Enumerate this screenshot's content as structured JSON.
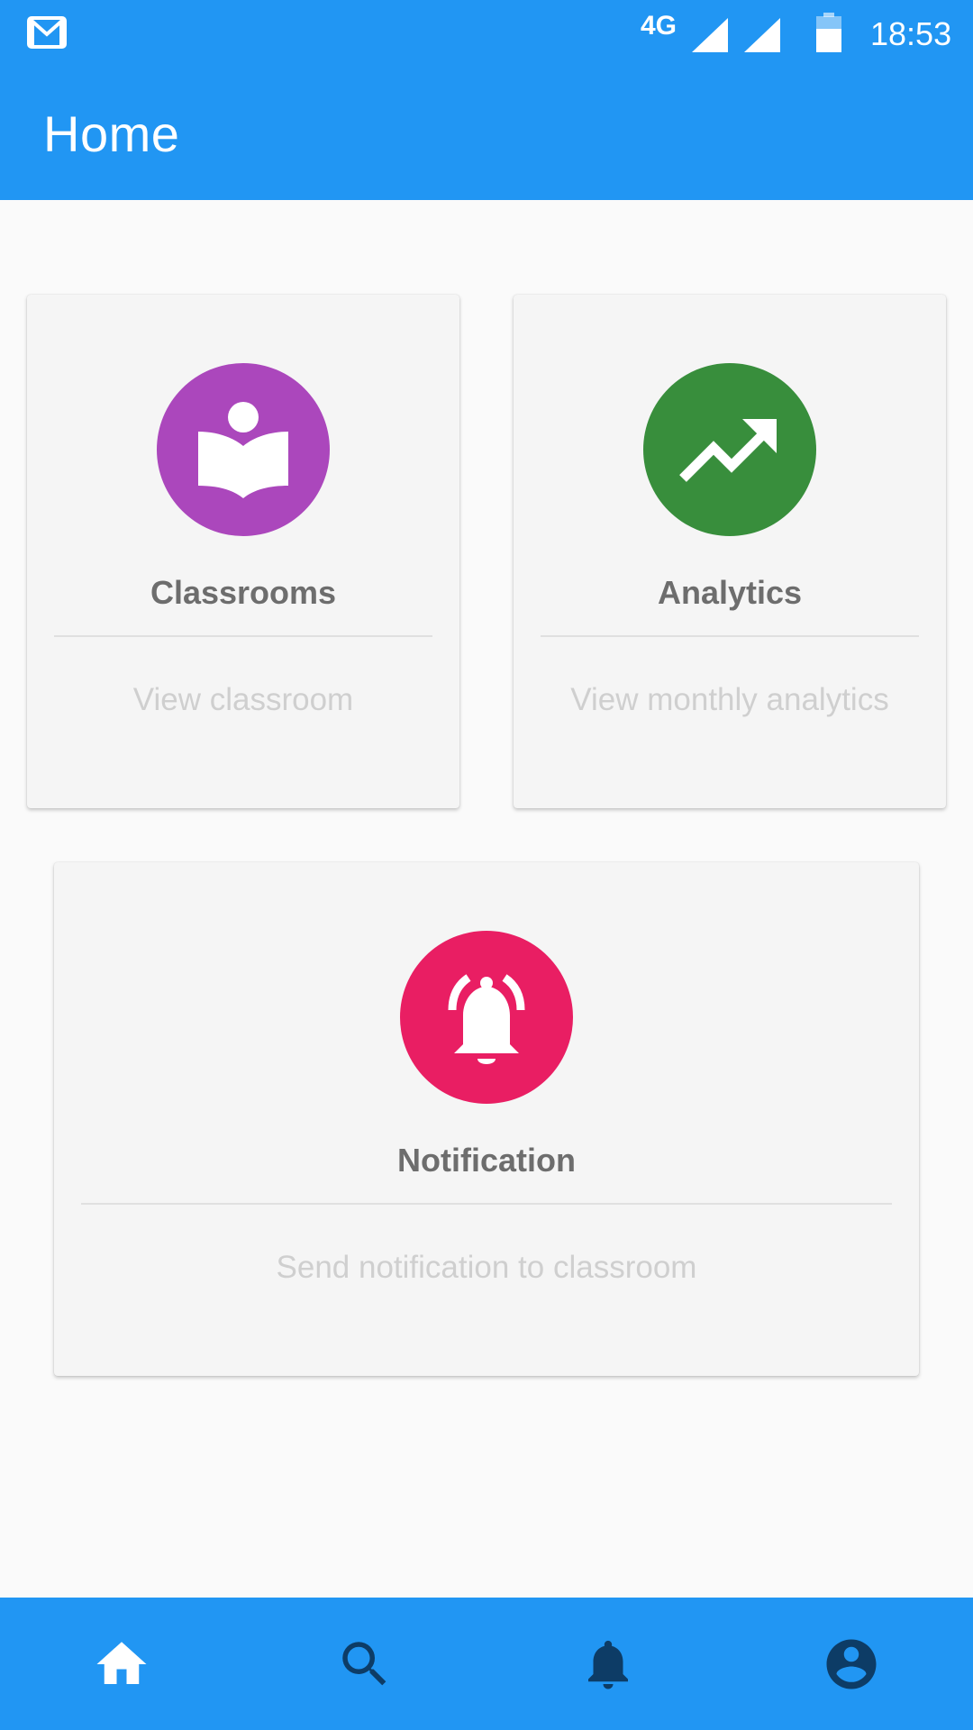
{
  "status_bar": {
    "network": "4G",
    "time": "18:53",
    "icons": [
      "gmail-icon",
      "signal-icon",
      "signal-icon",
      "battery-icon"
    ]
  },
  "app_bar": {
    "title": "Home"
  },
  "cards": [
    {
      "title": "Classrooms",
      "subtitle": "View classroom",
      "icon": "book-reader-icon",
      "color": "#ab47bc"
    },
    {
      "title": "Analytics",
      "subtitle": "View monthly analytics",
      "icon": "trending-up-icon",
      "color": "#388e3c"
    },
    {
      "title": "Notification",
      "subtitle": "Send notification to classroom",
      "icon": "notification-bell-icon",
      "color": "#e91e63"
    }
  ],
  "bottom_nav": {
    "items": [
      {
        "icon": "home-icon",
        "active": true
      },
      {
        "icon": "search-icon",
        "active": false
      },
      {
        "icon": "bell-icon",
        "active": false
      },
      {
        "icon": "account-icon",
        "active": false
      }
    ]
  },
  "colors": {
    "primary": "#2196f3",
    "inactive_icon": "#0d3c66",
    "active_icon": "#ffffff"
  }
}
